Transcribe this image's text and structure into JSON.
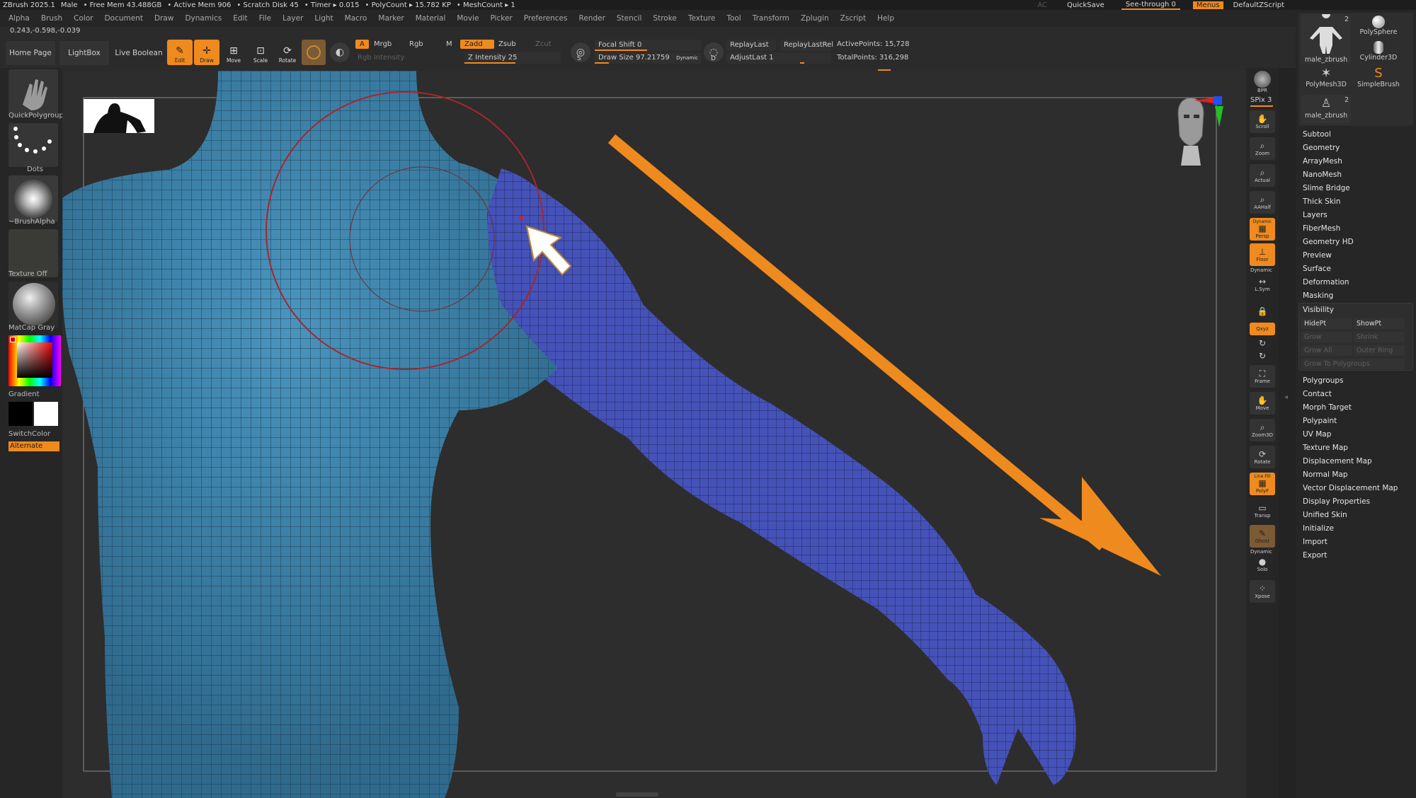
{
  "titlebar": {
    "app": "ZBrush 2025.1",
    "doc": "Male",
    "free_mem": "• Free Mem 43.488GB",
    "active_mem": "• Active Mem 906",
    "scratch": "• Scratch Disk 45",
    "timer": "• Timer ▸ 0.015",
    "polycount": "• PolyCount ▸ 15.782 KP",
    "meshcount": "• MeshCount ▸ 1",
    "ac": "AC",
    "quicksave": "QuickSave",
    "seethrough": "See-through  0",
    "menus": "Menus",
    "script": "DefaultZScript"
  },
  "menubar": [
    "Alpha",
    "Brush",
    "Color",
    "Document",
    "Draw",
    "Dynamics",
    "Edit",
    "File",
    "Layer",
    "Light",
    "Macro",
    "Marker",
    "Material",
    "Movie",
    "Picker",
    "Preferences",
    "Render",
    "Stencil",
    "Stroke",
    "Texture",
    "Tool",
    "Transform",
    "Zplugin",
    "Zscript",
    "Help"
  ],
  "coords": "0.243,-0.598,-0.039",
  "toolbar": {
    "home": "Home Page",
    "lightbox": "LightBox",
    "liveboolean": "Live Boolean",
    "edit": "Edit",
    "draw": "Draw",
    "move": "Move",
    "scale": "Scale",
    "rotate": "Rotate",
    "a": "A",
    "mrgb": "Mrgb",
    "rgb": "Rgb",
    "m": "M",
    "zadd": "Zadd",
    "zsub": "Zsub",
    "zcut": "Zcut",
    "rgb_intensity": "Rgb Intensity",
    "z_intensity": "Z Intensity 25",
    "focal_shift": "Focal Shift 0",
    "draw_size": "Draw Size 97.21759",
    "dynamic": "Dynamic",
    "replaylast": "ReplayLast",
    "replaylastrel": "ReplayLastRel",
    "adjustlast": "AdjustLast 1",
    "activepoints": "ActivePoints: 15,728",
    "totalpoints": "TotalPoints: 316,298",
    "s_label": "S",
    "d_label": "D"
  },
  "leftshelf": {
    "brush": "QuickPolygroup",
    "stroke": "Dots",
    "alpha": "~BrushAlpha",
    "texture": "Texture Off",
    "material": "MatCap Gray",
    "gradient": "Gradient",
    "switchcolor": "SwitchColor",
    "alternate": "Alternate"
  },
  "righticons": {
    "bpr": "BPR",
    "spix": "SPix 3",
    "scroll": "Scroll",
    "zoom": "Zoom",
    "actual": "Actual",
    "aahalf": "AAHalf",
    "dynamic_top": "Dynamic",
    "persp": "Persp",
    "floor": "Floor",
    "dynamic_mid": "Dynamic",
    "lsym": "L.Sym",
    "xyz": "Qxyz",
    "frame": "Frame",
    "move": "Move",
    "zoom3d": "Zoom3D",
    "rotate": "Rotate",
    "linefill": "Line Fill",
    "polyf": "PolyF",
    "transp": "Transp",
    "ghost": "Ghost",
    "dynamic_bot": "Dynamic",
    "solo": "Solo",
    "xpose": "Xpose"
  },
  "toolpanel": {
    "thumbs": [
      {
        "label": "male_zbrush",
        "badge": "2"
      },
      {
        "label": "PolySphere",
        "badge": ""
      },
      {
        "label": "Cylinder3D",
        "badge": ""
      },
      {
        "label": "PolyMesh3D",
        "badge": ""
      },
      {
        "label": "SimpleBrush",
        "badge": ""
      },
      {
        "label": "male_zbrush",
        "badge": "2"
      }
    ],
    "items_top": [
      "Subtool",
      "Geometry",
      "ArrayMesh",
      "NanoMesh",
      "Slime Bridge",
      "Thick Skin",
      "Layers",
      "FiberMesh",
      "Geometry HD",
      "Preview",
      "Surface",
      "Deformation",
      "Masking"
    ],
    "visibility": {
      "title": "Visibility",
      "hidept": "HidePt",
      "showpt": "ShowPt",
      "grow": "Grow",
      "shrink": "Shrink",
      "growall": "Grow All",
      "outerring": "Outer Ring",
      "growtopolygroups": "Grow To Polygroups"
    },
    "items_bottom": [
      "Polygroups",
      "Contact",
      "Morph Target",
      "Polypaint",
      "UV Map",
      "Texture Map",
      "Displacement Map",
      "Normal Map",
      "Vector Displacement Map",
      "Display Properties",
      "Unified Skin",
      "Initialize",
      "Import",
      "Export"
    ]
  },
  "colors": {
    "accent": "#ef8a1e",
    "mesh_teal": "#3c7ea2",
    "mesh_blue": "#4552b8",
    "background": "#2b2b2b"
  }
}
